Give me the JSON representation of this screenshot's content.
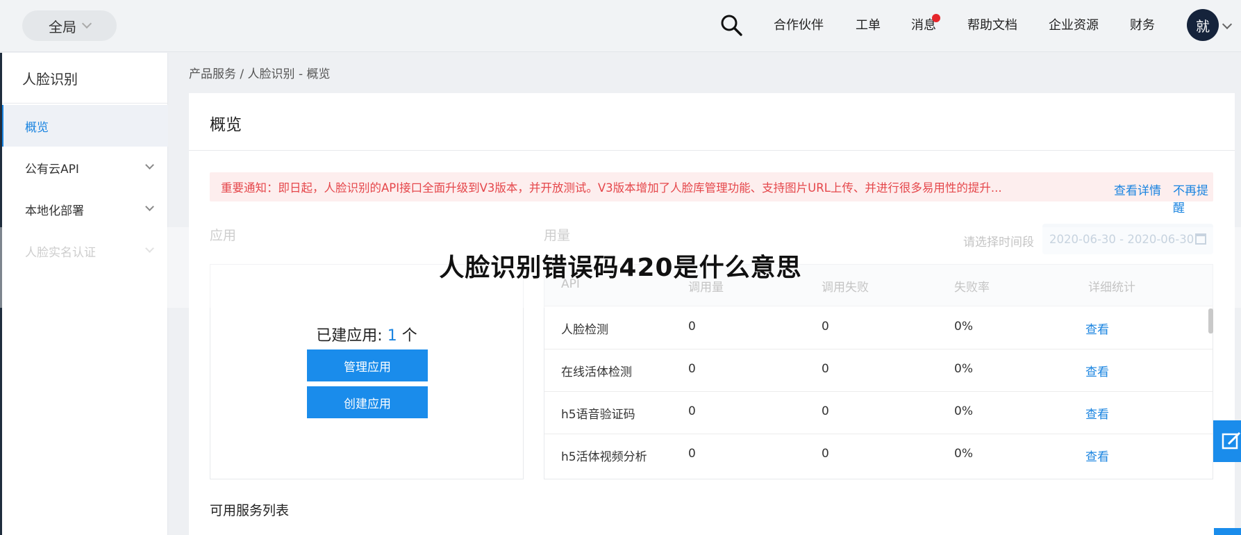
{
  "topbar": {
    "scope_label": "全局",
    "nav": [
      "合作伙伴",
      "工单",
      "消息",
      "帮助文档",
      "企业资源",
      "财务"
    ],
    "avatar_text": "就"
  },
  "sidebar": {
    "title": "人脸识别",
    "items": [
      {
        "label": "概览",
        "active": true
      },
      {
        "label": "公有云API"
      },
      {
        "label": "本地化部署"
      },
      {
        "label": "人脸实名认证"
      }
    ]
  },
  "breadcrumb": "产品服务  /  人脸识别 - 概览",
  "main": {
    "title": "概览",
    "notice": "重要通知：即日起，人脸识别的API接口全面升级到V3版本，并开放测试。V3版本增加了人脸库管理功能、支持图片URL上传、并进行很多易用性的提升...",
    "notice_detail": "查看详情",
    "notice_dismiss": "不再提醒",
    "apps_label": "应用",
    "usage_label": "用量",
    "date_label": "请选择时间段",
    "date_range": "2020-06-30 - 2020-06-30",
    "apps": {
      "count_prefix": "已建应用: ",
      "count": "1",
      "count_suffix": " 个",
      "manage_btn": "管理应用",
      "create_btn": "创建应用"
    },
    "table": {
      "headers": [
        "API",
        "调用量",
        "调用失败",
        "失败率",
        "详细统计"
      ],
      "rows": [
        [
          "人脸检测",
          "0",
          "0",
          "0%",
          "查看"
        ],
        [
          "在线活体检测",
          "0",
          "0",
          "0%",
          "查看"
        ],
        [
          "h5语音验证码",
          "0",
          "0",
          "0%",
          "查看"
        ],
        [
          "h5活体视频分析",
          "0",
          "0",
          "0%",
          "查看"
        ]
      ]
    },
    "service_list_title": "可用服务列表"
  },
  "overlay": {
    "headline": "人脸识别错误码420是什么意思"
  },
  "colors": {
    "accent": "#1a84e0",
    "notice_text": "#e5474b",
    "notice_bg": "#fdeeee",
    "badge": "#e5262b"
  }
}
